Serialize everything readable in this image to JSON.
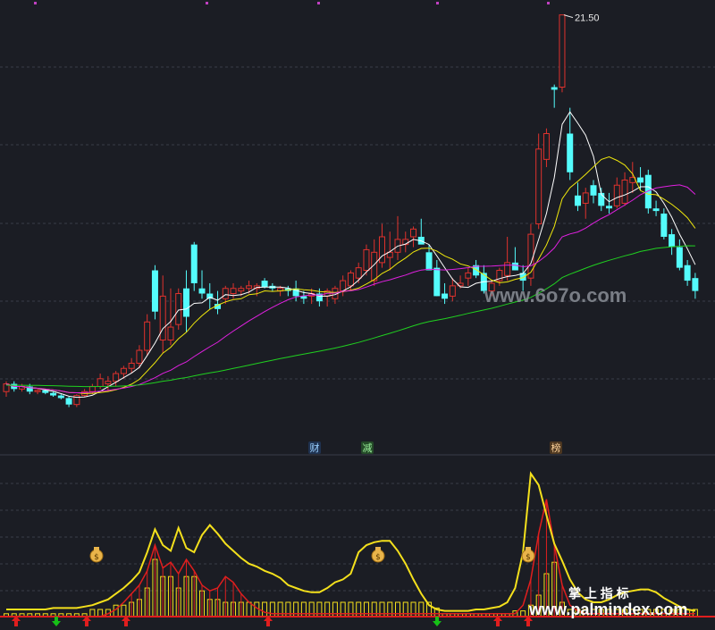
{
  "chart_data": [
    {
      "type": "candlestick",
      "panel": "main",
      "ylim": [
        5.8,
        21.8
      ],
      "peak_label": "21.50",
      "candles": [
        [
          6.9,
          7.3,
          6.7,
          7.2
        ],
        [
          7.2,
          7.3,
          6.9,
          7.0
        ],
        [
          7.0,
          7.2,
          6.9,
          7.1
        ],
        [
          7.1,
          7.2,
          6.8,
          6.9
        ],
        [
          6.9,
          7.0,
          6.8,
          6.95
        ],
        [
          6.95,
          7.0,
          6.8,
          6.85
        ],
        [
          6.85,
          6.9,
          6.7,
          6.75
        ],
        [
          6.75,
          6.8,
          6.6,
          6.65
        ],
        [
          6.65,
          6.7,
          6.3,
          6.4
        ],
        [
          6.4,
          6.8,
          6.3,
          6.75
        ],
        [
          6.75,
          7.0,
          6.7,
          6.9
        ],
        [
          6.9,
          7.2,
          6.8,
          7.1
        ],
        [
          7.1,
          7.6,
          7.0,
          7.4
        ],
        [
          7.2,
          7.5,
          6.9,
          7.3
        ],
        [
          7.3,
          7.7,
          7.1,
          7.6
        ],
        [
          7.6,
          7.9,
          7.4,
          7.8
        ],
        [
          7.8,
          8.2,
          7.6,
          8.0
        ],
        [
          8.0,
          8.7,
          7.8,
          8.5
        ],
        [
          8.5,
          9.9,
          8.3,
          9.6
        ],
        [
          11.6,
          11.8,
          9.7,
          10.0
        ],
        [
          8.9,
          11.4,
          8.4,
          10.6
        ],
        [
          8.9,
          10.9,
          8.7,
          9.4
        ],
        [
          9.5,
          10.9,
          9.3,
          10.7
        ],
        [
          10.9,
          11.6,
          9.2,
          9.8
        ],
        [
          12.6,
          12.7,
          10.8,
          11.1
        ],
        [
          10.9,
          11.6,
          10.5,
          10.7
        ],
        [
          10.7,
          11.1,
          10.1,
          10.5
        ],
        [
          10.3,
          10.8,
          9.9,
          10.1
        ],
        [
          10.5,
          11.0,
          10.3,
          10.9
        ],
        [
          10.7,
          11.1,
          10.5,
          10.9
        ],
        [
          10.8,
          11.0,
          10.6,
          10.9
        ],
        [
          10.9,
          11.2,
          10.7,
          11.0
        ],
        [
          10.9,
          11.1,
          10.6,
          11.0
        ],
        [
          11.2,
          11.3,
          10.9,
          10.95
        ],
        [
          11.0,
          11.1,
          10.8,
          10.9
        ],
        [
          10.8,
          11.0,
          10.6,
          10.9
        ],
        [
          10.9,
          11.0,
          10.6,
          10.8
        ],
        [
          10.9,
          11.2,
          10.4,
          10.6
        ],
        [
          10.6,
          10.8,
          10.3,
          10.5
        ],
        [
          10.6,
          10.9,
          10.3,
          10.7
        ],
        [
          10.7,
          10.9,
          10.2,
          10.4
        ],
        [
          10.6,
          10.9,
          10.2,
          10.8
        ],
        [
          10.5,
          11.0,
          10.3,
          10.9
        ],
        [
          10.8,
          11.4,
          10.6,
          11.2
        ],
        [
          11.0,
          11.6,
          10.8,
          11.5
        ],
        [
          11.3,
          11.9,
          11.1,
          11.7
        ],
        [
          11.6,
          12.6,
          11.4,
          12.4
        ],
        [
          11.2,
          12.8,
          11.0,
          12.3
        ],
        [
          11.9,
          13.4,
          11.7,
          12.9
        ],
        [
          12.1,
          13.1,
          11.6,
          12.3
        ],
        [
          12.3,
          13.7,
          12.0,
          12.8
        ],
        [
          12.6,
          13.1,
          12.3,
          12.8
        ],
        [
          12.9,
          13.3,
          12.5,
          13.2
        ],
        [
          12.9,
          13.6,
          12.7,
          12.6
        ],
        [
          12.3,
          12.6,
          11.6,
          11.6
        ],
        [
          11.7,
          12.0,
          10.6,
          10.6
        ],
        [
          10.7,
          11.1,
          10.3,
          10.5
        ],
        [
          10.6,
          11.3,
          10.4,
          11.0
        ],
        [
          11.0,
          11.4,
          10.9,
          11.1
        ],
        [
          11.3,
          11.7,
          11.0,
          11.5
        ],
        [
          11.8,
          12.0,
          11.3,
          11.4
        ],
        [
          11.5,
          11.8,
          10.7,
          10.8
        ],
        [
          10.8,
          11.2,
          10.6,
          11.1
        ],
        [
          11.2,
          11.7,
          11.0,
          11.6
        ],
        [
          11.4,
          12.9,
          11.2,
          11.9
        ],
        [
          11.9,
          12.5,
          11.6,
          11.6
        ],
        [
          11.5,
          11.8,
          10.8,
          11.2
        ],
        [
          11.3,
          13.4,
          11.0,
          13.0
        ],
        [
          13.4,
          16.9,
          13.2,
          16.3
        ],
        [
          15.9,
          17.1,
          15.6,
          16.9
        ],
        [
          18.7,
          18.8,
          17.9,
          18.6
        ],
        [
          18.7,
          21.5,
          18.5,
          21.5
        ],
        [
          16.9,
          17.9,
          15.1,
          15.4
        ],
        [
          14.5,
          15.0,
          13.9,
          14.1
        ],
        [
          14.2,
          14.8,
          13.6,
          14.6
        ],
        [
          14.9,
          15.1,
          14.2,
          14.5
        ],
        [
          14.6,
          14.8,
          13.9,
          14.1
        ],
        [
          14.1,
          14.6,
          13.8,
          14.0
        ],
        [
          14.1,
          15.2,
          14.0,
          14.9
        ],
        [
          14.2,
          15.4,
          14.1,
          15.1
        ],
        [
          15.0,
          15.8,
          14.6,
          15.2
        ],
        [
          15.2,
          15.6,
          14.7,
          15.0
        ],
        [
          15.3,
          15.5,
          13.8,
          14.0
        ],
        [
          14.0,
          14.3,
          13.7,
          13.9
        ],
        [
          13.8,
          14.0,
          12.8,
          12.9
        ],
        [
          13.0,
          13.2,
          12.2,
          12.5
        ],
        [
          12.5,
          12.8,
          11.6,
          11.7
        ],
        [
          11.8,
          12.0,
          11.0,
          11.2
        ],
        [
          11.3,
          11.5,
          10.5,
          10.8
        ]
      ],
      "series": [
        {
          "name": "",
          "color": "#ffffff",
          "period": 5
        },
        {
          "name": "",
          "color": "#f0e80c",
          "period": 10
        },
        {
          "name": "",
          "color": "#e020e0",
          "period": 20
        },
        {
          "name": "",
          "color": "#20d020",
          "period": 60
        }
      ],
      "colors": {
        "up": "#e0322d",
        "down": "#54fcfc",
        "background": "#1b1d24",
        "grid": "#3a3d48"
      }
    },
    {
      "type": "bar",
      "panel": "indicator",
      "ylim": [
        0,
        1
      ],
      "bars": [
        0.02,
        0.02,
        0.02,
        0.02,
        0.02,
        0.02,
        0.02,
        0.02,
        0.02,
        0.02,
        0.02,
        0.05,
        0.05,
        0.05,
        0.08,
        0.08,
        0.1,
        0.12,
        0.2,
        0.4,
        0.28,
        0.28,
        0.2,
        0.28,
        0.28,
        0.18,
        0.12,
        0.12,
        0.1,
        0.1,
        0.1,
        0.1,
        0.1,
        0.1,
        0.1,
        0.1,
        0.1,
        0.1,
        0.1,
        0.1,
        0.1,
        0.1,
        0.1,
        0.1,
        0.1,
        0.1,
        0.1,
        0.1,
        0.1,
        0.1,
        0.1,
        0.1,
        0.1,
        0.1,
        0.1,
        0.06,
        0.02,
        0.02,
        0.02,
        0.02,
        0.02,
        0.02,
        0.02,
        0.02,
        0.02,
        0.04,
        0.04,
        0.08,
        0.15,
        0.3,
        0.38,
        0.1,
        0.05,
        0.05,
        0.05,
        0.05,
        0.05,
        0.05,
        0.05,
        0.05,
        0.05,
        0.05,
        0.05,
        0.05,
        0.05,
        0.05,
        0.05,
        0.05,
        0.05,
        0.05,
        0.05
      ],
      "line": [
        0.05,
        0.05,
        0.05,
        0.05,
        0.05,
        0.05,
        0.06,
        0.06,
        0.06,
        0.06,
        0.07,
        0.08,
        0.1,
        0.12,
        0.16,
        0.2,
        0.25,
        0.31,
        0.45,
        0.61,
        0.5,
        0.46,
        0.62,
        0.48,
        0.45,
        0.57,
        0.64,
        0.58,
        0.51,
        0.46,
        0.41,
        0.37,
        0.35,
        0.32,
        0.3,
        0.27,
        0.22,
        0.2,
        0.18,
        0.17,
        0.17,
        0.2,
        0.24,
        0.26,
        0.3,
        0.45,
        0.5,
        0.52,
        0.53,
        0.53,
        0.46,
        0.37,
        0.26,
        0.16,
        0.08,
        0.05,
        0.04,
        0.04,
        0.04,
        0.04,
        0.05,
        0.05,
        0.06,
        0.07,
        0.1,
        0.2,
        0.45,
        1.0,
        0.92,
        0.71,
        0.51,
        0.39,
        0.26,
        0.17,
        0.12,
        0.1,
        0.1,
        0.12,
        0.15,
        0.17,
        0.18,
        0.19,
        0.19,
        0.17,
        0.13,
        0.1,
        0.07,
        0.05,
        0.04,
        0.03,
        0.02
      ],
      "red_line": [
        0,
        0,
        0,
        0,
        0,
        0,
        0,
        0,
        0,
        0,
        0,
        0,
        0,
        0.02,
        0.05,
        0.1,
        0.16,
        0.22,
        0.32,
        0.5,
        0.34,
        0.38,
        0.3,
        0.4,
        0.32,
        0.22,
        0.18,
        0.2,
        0.28,
        0.24,
        0.16,
        0.1,
        0.06,
        0.03,
        0.02,
        0.02,
        0.02,
        0.02,
        0.02,
        0.02,
        0.02,
        0.02,
        0.02,
        0.02,
        0.02,
        0.02,
        0.02,
        0.02,
        0.02,
        0.02,
        0.02,
        0.02,
        0.02,
        0.02,
        0.02,
        0.02,
        0.02,
        0.02,
        0.02,
        0.02,
        0.02,
        0.02,
        0.02,
        0.02,
        0.02,
        0.02,
        0.08,
        0.26,
        0.58,
        0.82,
        0.5,
        0.22,
        0.08,
        0.04,
        0.02,
        0.02,
        0.02,
        0.02,
        0.02,
        0.02,
        0.02,
        0.02,
        0.02,
        0.02,
        0.02,
        0.02,
        0.02,
        0.02,
        0.02,
        0.02,
        0.02
      ],
      "red_arrows": [
        1,
        5,
        9,
        31,
        58,
        62
      ],
      "green_arrows": [
        2,
        49
      ],
      "money_bags": [
        11,
        44,
        62
      ],
      "colors": {
        "line": "#f4e01c",
        "bar": "#f4e01c",
        "red": "#e01e1e",
        "green": "#16c016"
      }
    }
  ],
  "badges": [
    {
      "text": "财",
      "color": "#9ad0ff",
      "bg": "#1f3250"
    },
    {
      "text": "减",
      "color": "#9cf29c",
      "bg": "#244a28"
    },
    {
      "text": "榜",
      "color": "#ffd39a",
      "bg": "#4d3720"
    }
  ],
  "watermarks": {
    "site1": "www.6o7o.com",
    "cn_label": "掌 上 指 标",
    "site2": "www.palmindex.com"
  }
}
